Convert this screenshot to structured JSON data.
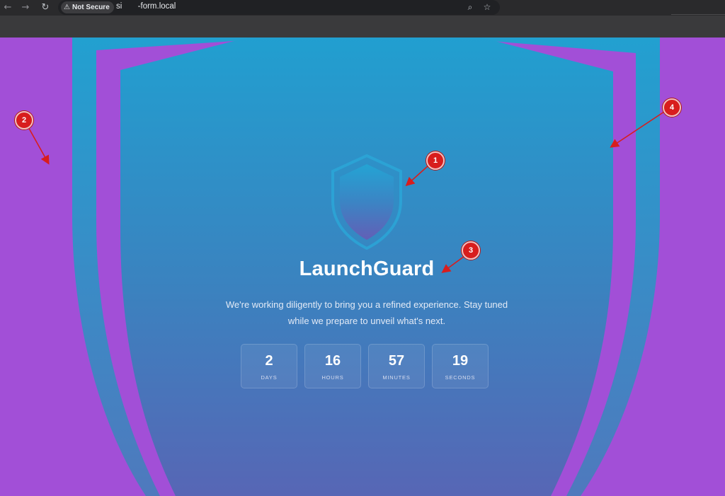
{
  "browser": {
    "security_label": "Not Secure",
    "url": "si       -form.local",
    "icons": [
      "back-icon",
      "forward-icon",
      "reload-icon",
      "warning-icon",
      "zoom-icon",
      "bookmark-star-icon"
    ]
  },
  "page": {
    "brand": "LaunchGuard",
    "tagline_line1": "We're working diligently to bring you a refined experience. Stay tuned",
    "tagline_line2": "while we prepare to unveil what's next.",
    "countdown": [
      {
        "value": "2",
        "label": "DAYS"
      },
      {
        "value": "16",
        "label": "HOURS"
      },
      {
        "value": "57",
        "label": "MINUTES"
      },
      {
        "value": "19",
        "label": "SECONDS"
      }
    ]
  },
  "annotations": [
    "1",
    "2",
    "3",
    "4"
  ],
  "colors": {
    "background_purple": "#a24fd7",
    "shield_blue_top": "#219fd0",
    "shield_blue_bottom": "#5766b5",
    "annotation_red": "#d81d1d"
  }
}
